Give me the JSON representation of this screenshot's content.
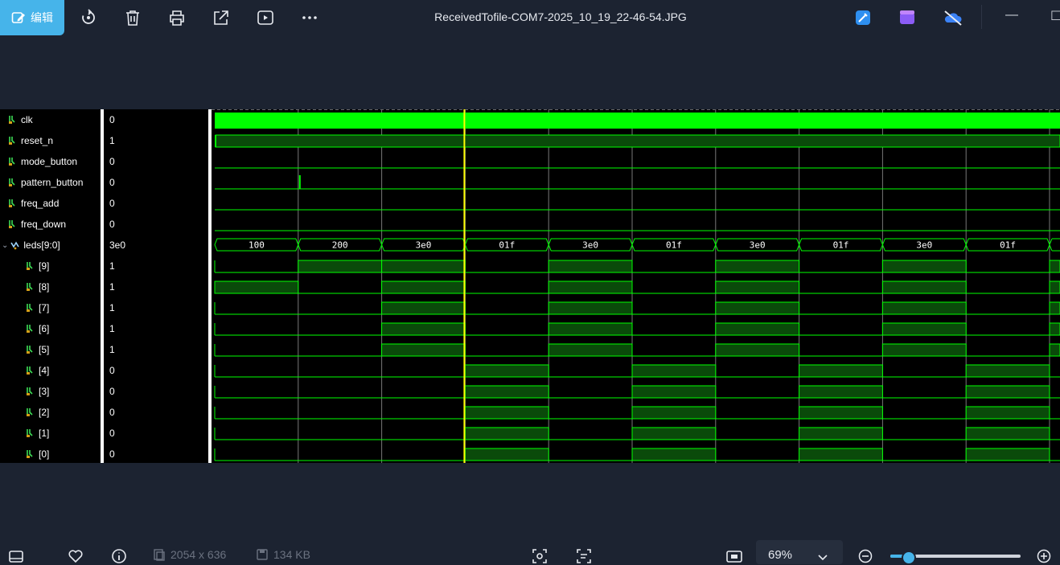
{
  "toolbar": {
    "edit_label": "编辑",
    "icons": [
      "edit-image-icon",
      "rotate-icon",
      "delete-icon",
      "print-icon",
      "share-icon",
      "slideshow-icon",
      "more-icon"
    ]
  },
  "window": {
    "title": "ReceivedTofile-COM7-2025_10_19_22-46-54.JPG",
    "controls": [
      "minimize",
      "maximize"
    ]
  },
  "colors": {
    "accent": "#46b4ea",
    "wave_green": "#00ff00",
    "wave_fill": "#0a4a0a",
    "cursor": "#ffff00",
    "background": "#1c2331"
  },
  "waveform": {
    "signals": [
      {
        "name": "clk",
        "value": "0",
        "icon": "signal-icon",
        "indent": false
      },
      {
        "name": "reset_n",
        "value": "1",
        "icon": "signal-icon",
        "indent": false
      },
      {
        "name": "mode_button",
        "value": "0",
        "icon": "signal-icon",
        "indent": false
      },
      {
        "name": "pattern_button",
        "value": "0",
        "icon": "signal-icon",
        "indent": false
      },
      {
        "name": "freq_add",
        "value": "0",
        "icon": "signal-icon",
        "indent": false
      },
      {
        "name": "freq_down",
        "value": "0",
        "icon": "signal-icon",
        "indent": false
      },
      {
        "name": "leds[9:0]",
        "value": "3e0",
        "icon": "bus-icon",
        "indent": false
      },
      {
        "name": "[9]",
        "value": "1",
        "icon": "signal-icon",
        "indent": true
      },
      {
        "name": "[8]",
        "value": "1",
        "icon": "signal-icon",
        "indent": true
      },
      {
        "name": "[7]",
        "value": "1",
        "icon": "signal-icon",
        "indent": true
      },
      {
        "name": "[6]",
        "value": "1",
        "icon": "signal-icon",
        "indent": true
      },
      {
        "name": "[5]",
        "value": "1",
        "icon": "signal-icon",
        "indent": true
      },
      {
        "name": "[4]",
        "value": "0",
        "icon": "signal-icon",
        "indent": true
      },
      {
        "name": "[3]",
        "value": "0",
        "icon": "signal-icon",
        "indent": true
      },
      {
        "name": "[2]",
        "value": "0",
        "icon": "signal-icon",
        "indent": true
      },
      {
        "name": "[1]",
        "value": "0",
        "icon": "signal-icon",
        "indent": true
      },
      {
        "name": "[0]",
        "value": "0",
        "icon": "signal-icon",
        "indent": true
      }
    ],
    "bus_values": [
      "100",
      "200",
      "3e0",
      "01f",
      "3e0",
      "01f",
      "3e0",
      "01f",
      "3e0",
      "01f"
    ]
  },
  "statusbar": {
    "dimensions": "2054 x 636",
    "filesize": "134 KB",
    "zoom": "69%",
    "zoom_level": 0.14
  }
}
